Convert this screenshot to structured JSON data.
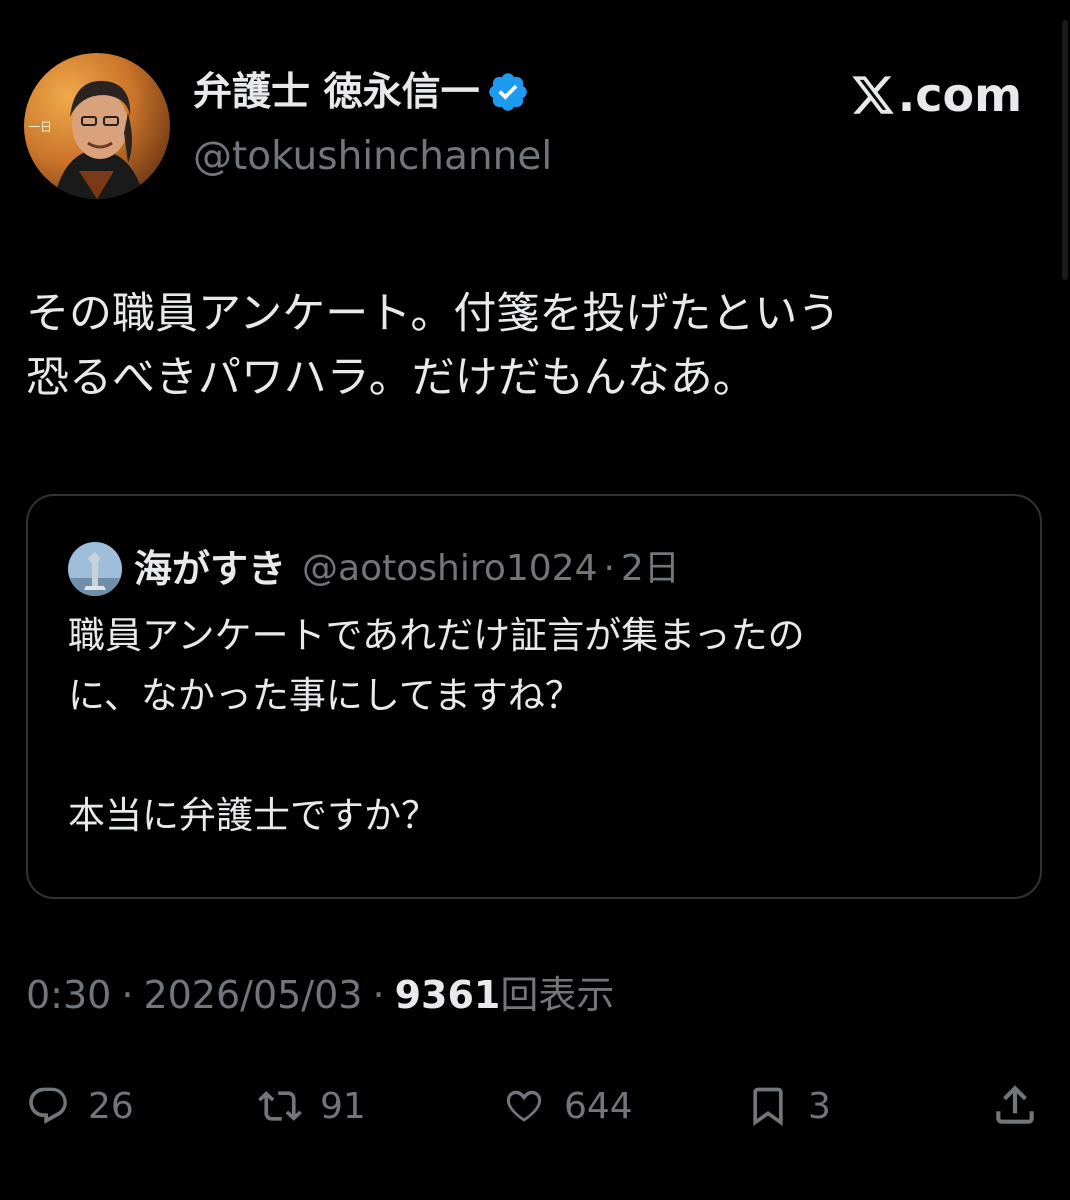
{
  "author": {
    "name": "弁護士 徳永信一",
    "handle": "@tokushinchannel",
    "verified": true,
    "verified_color": "#1d9bf0"
  },
  "brand": {
    "label": ".com"
  },
  "tweet": {
    "lines": [
      "その職員アンケート。付箋を投げたという",
      "恐るべきパワハラ。だけだもんなあ。"
    ]
  },
  "quote": {
    "name": "海がすき",
    "handle": "@aotoshiro1024",
    "separator": "·",
    "time": "2日",
    "lines": [
      "職員アンケートであれだけ証言が集まったの",
      "に、なかった事にしてますね？",
      "",
      "本当に弁護士ですか？"
    ]
  },
  "meta": {
    "time": "0:30",
    "separator": "·",
    "date": "2026/05/03",
    "views_count": "9361",
    "views_label": "回表示"
  },
  "actions": {
    "replies": "26",
    "reposts": "91",
    "likes": "644",
    "bookmarks": "3"
  },
  "colors": {
    "background": "#000000",
    "text": "#e7e9ea",
    "muted": "#71767b",
    "border": "#2f3336"
  }
}
